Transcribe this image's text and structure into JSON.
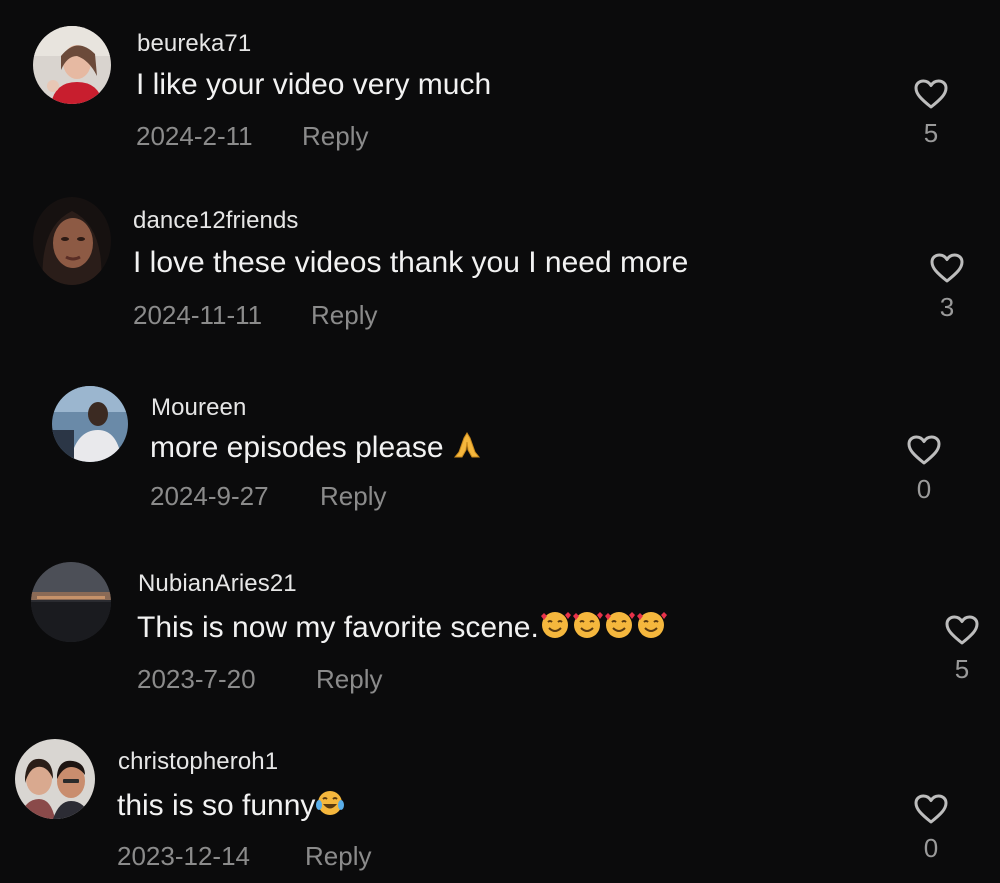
{
  "colors": {
    "background": "#0b0b0c",
    "text": "#f2f2f2",
    "muted": "#8b8b8b",
    "heart_stroke": "#bdbdbd"
  },
  "comments": [
    {
      "username": "beureka71",
      "text": "I like your video very much",
      "emoji": "",
      "date": "2024-2-11",
      "reply_label": "Reply",
      "likes": "5",
      "icon": "heart-outline-icon"
    },
    {
      "username": "dance12friends",
      "text": "I love these videos thank you I need more",
      "emoji": "",
      "date": "2024-11-11",
      "reply_label": "Reply",
      "likes": "3",
      "icon": "heart-outline-icon"
    },
    {
      "username": "Moureen",
      "text": "more episodes please ",
      "emoji": "folded-hands-emoji",
      "date": "2024-9-27",
      "reply_label": "Reply",
      "likes": "0",
      "icon": "heart-outline-icon"
    },
    {
      "username": "NubianAries21",
      "text": "This is now my favorite scene.",
      "emoji": "smiling-face-with-hearts-emoji x4",
      "date": "2023-7-20",
      "reply_label": "Reply",
      "likes": "5",
      "icon": "heart-outline-icon"
    },
    {
      "username": "christopheroh1",
      "text": "this is so funny",
      "emoji": "tears-of-joy-emoji",
      "date": "2023-12-14",
      "reply_label": "Reply",
      "likes": "0",
      "icon": "heart-outline-icon"
    }
  ]
}
